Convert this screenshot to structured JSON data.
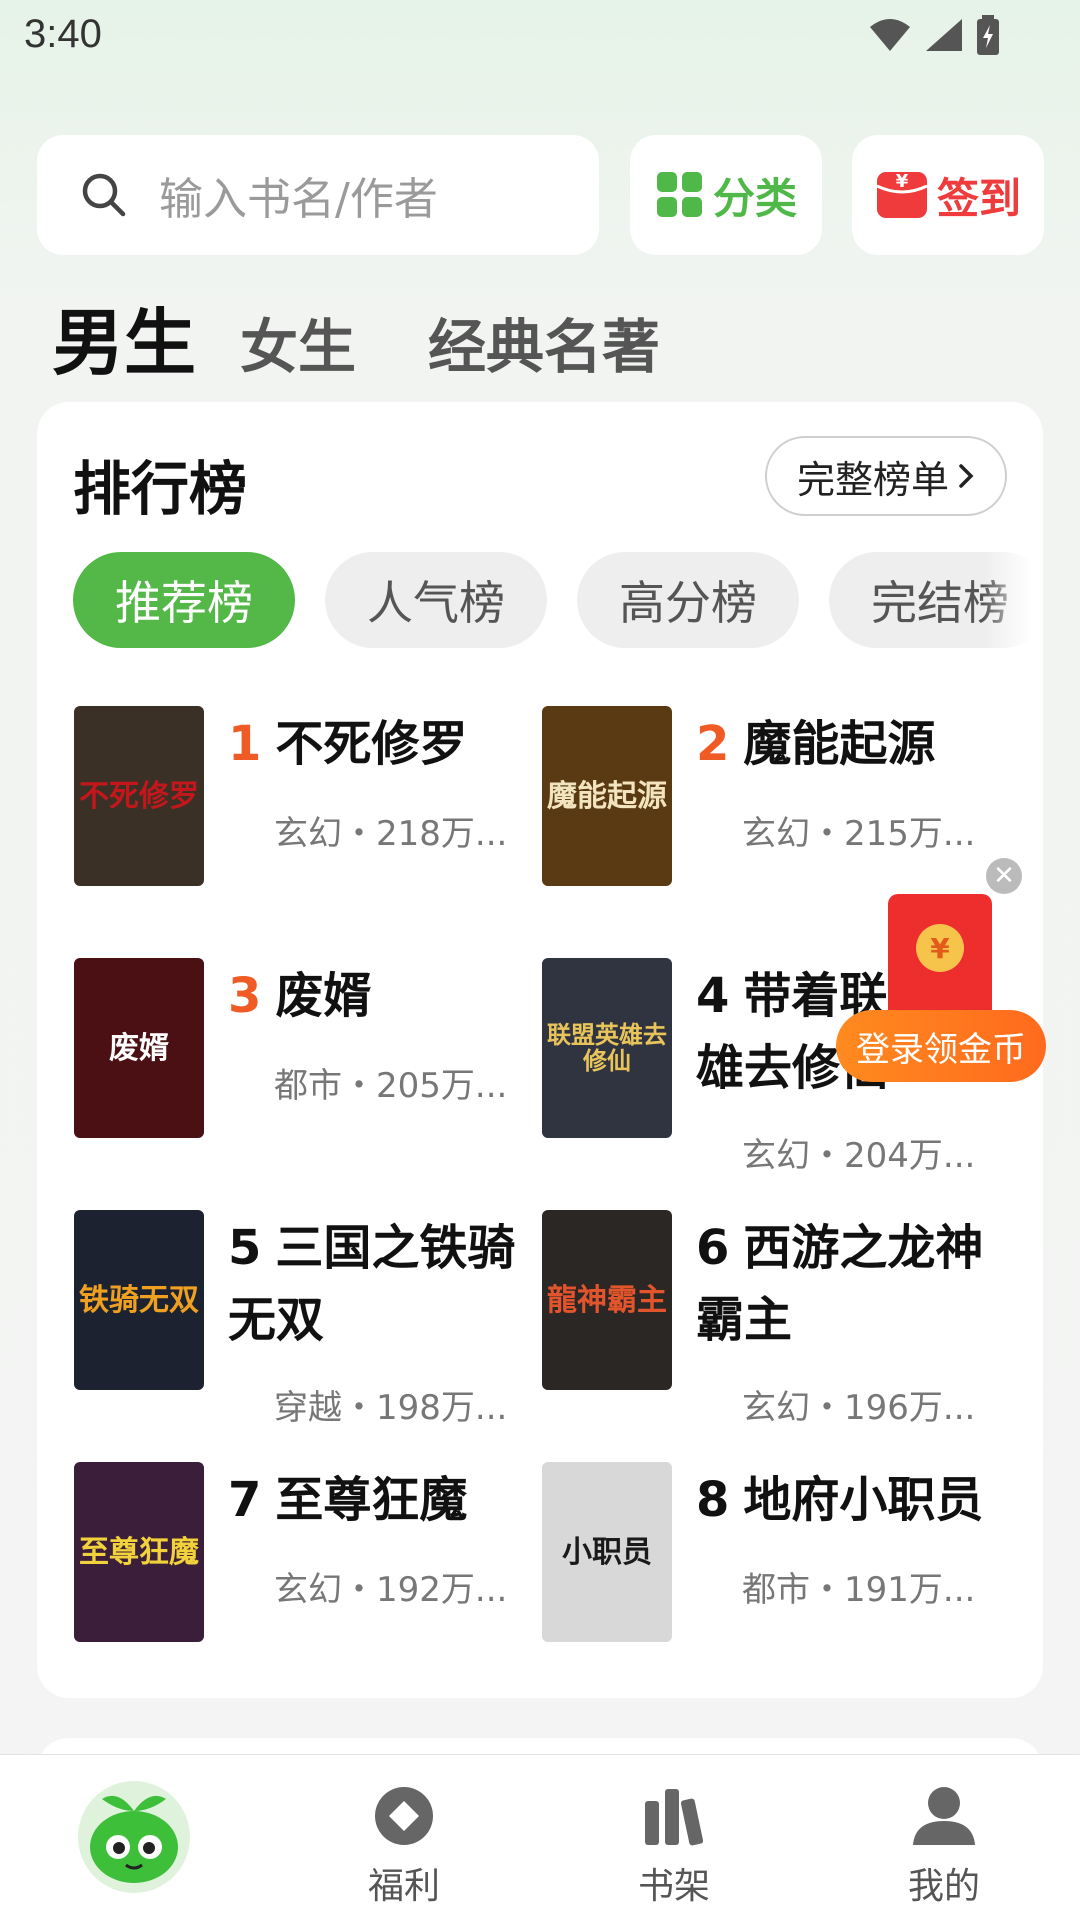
{
  "status_bar": {
    "time": "3:40"
  },
  "search": {
    "placeholder": "输入书名/作者"
  },
  "header_buttons": {
    "category_label": "分类",
    "sign_in_label": "签到"
  },
  "gender_tabs": [
    {
      "label": "男生",
      "active": true
    },
    {
      "label": "女生",
      "active": false
    },
    {
      "label": "经典名著",
      "active": false
    }
  ],
  "ranking": {
    "title": "排行榜",
    "full_list_label": "完整榜单",
    "tabs": [
      {
        "label": "推荐榜",
        "active": true
      },
      {
        "label": "人气榜",
        "active": false
      },
      {
        "label": "高分榜",
        "active": false
      },
      {
        "label": "完结榜",
        "active": false
      }
    ],
    "books": [
      {
        "rank": "1",
        "title": "不死修罗",
        "meta": "玄幻・218万...",
        "cover_text": "不死修罗",
        "cover_bg": "#3a3026",
        "cover_fg": "#c3171c"
      },
      {
        "rank": "2",
        "title": "魔能起源",
        "meta": "玄幻・215万...",
        "cover_text": "魔能起源",
        "cover_bg": "#5a3a12",
        "cover_fg": "#f3e4c0"
      },
      {
        "rank": "3",
        "title": "废婿",
        "meta": "都市・205万...",
        "cover_text": "废婿",
        "cover_bg": "#4a1014",
        "cover_fg": "#ffffff"
      },
      {
        "rank": "4",
        "title": "带着联盟英雄去修仙",
        "meta": "玄幻・204万...",
        "cover_text": "联盟英雄去修仙",
        "cover_bg": "#2f3440",
        "cover_fg": "#e8c45a"
      },
      {
        "rank": "5",
        "title": "三国之铁骑无双",
        "meta": "穿越・198万...",
        "cover_text": "铁骑无双",
        "cover_bg": "#1c2230",
        "cover_fg": "#f0a020"
      },
      {
        "rank": "6",
        "title": "西游之龙神霸主",
        "meta": "玄幻・196万...",
        "cover_text": "龍神霸主",
        "cover_bg": "#2a2724",
        "cover_fg": "#e2542c"
      },
      {
        "rank": "7",
        "title": "至尊狂魔",
        "meta": "玄幻・192万...",
        "cover_text": "至尊狂魔",
        "cover_bg": "#3b1f3a",
        "cover_fg": "#f2d23a"
      },
      {
        "rank": "8",
        "title": "地府小职员",
        "meta": "都市・191万...",
        "cover_text": "小职员",
        "cover_bg": "#d8d8d8",
        "cover_fg": "#1a1a1a"
      }
    ]
  },
  "promo": {
    "label": "登录领金币"
  },
  "bottom_nav": [
    {
      "label": "",
      "icon": "app-logo-icon"
    },
    {
      "label": "福利",
      "icon": "diamond-icon"
    },
    {
      "label": "书架",
      "icon": "bookshelf-icon"
    },
    {
      "label": "我的",
      "icon": "profile-icon"
    }
  ],
  "colors": {
    "accent_green": "#53b848",
    "sign_red": "#ef3b3b",
    "hot_orange": "#f05a24"
  }
}
